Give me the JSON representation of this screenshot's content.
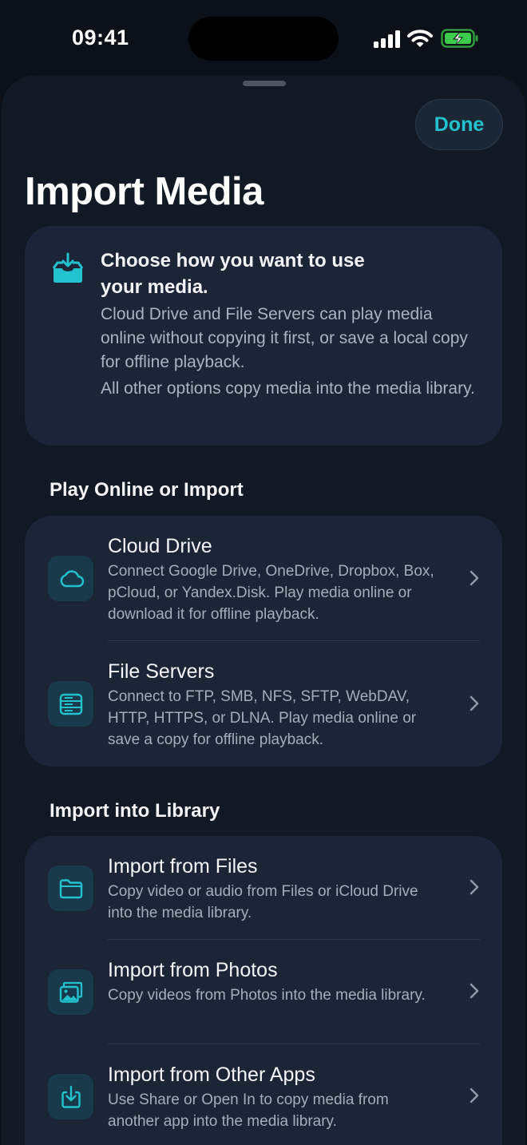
{
  "status_bar": {
    "time": "09:41"
  },
  "sheet": {
    "done_label": "Done",
    "title": "Import Media"
  },
  "info": {
    "icon": "tray-download-icon",
    "heading": "Choose how you want to use your media.",
    "text1": "Cloud Drive and File Servers can play media online without copying it first, or save a local copy for offline playback.",
    "text2": "All other options copy media into the media library."
  },
  "sections": [
    {
      "header": "Play Online or Import",
      "items": [
        {
          "icon": "cloud-icon",
          "title": "Cloud Drive",
          "description": "Connect Google Drive, OneDrive, Dropbox, Box, pCloud, or Yandex.Disk. Play media online or download it for offline playback."
        },
        {
          "icon": "server-icon",
          "title": "File Servers",
          "description": "Connect to FTP, SMB, NFS, SFTP, WebDAV, HTTP, HTTPS, or DLNA. Play media online or save a copy for offline playback."
        }
      ]
    },
    {
      "header": "Import into Library",
      "items": [
        {
          "icon": "folder-icon",
          "title": "Import from Files",
          "description": "Copy video or audio from Files or iCloud Drive into the media library."
        },
        {
          "icon": "photos-icon",
          "title": "Import from Photos",
          "description": "Copy videos from Photos into the media library."
        },
        {
          "icon": "share-import-icon",
          "title": "Import from Other Apps",
          "description": "Use Share or Open In to copy media from another app into the media library."
        }
      ]
    }
  ],
  "colors": {
    "accent": "#22c3cf",
    "background": "#0c1119",
    "sheet": "#111925",
    "card": "#1b2536",
    "battery": "#3ccb4a"
  }
}
